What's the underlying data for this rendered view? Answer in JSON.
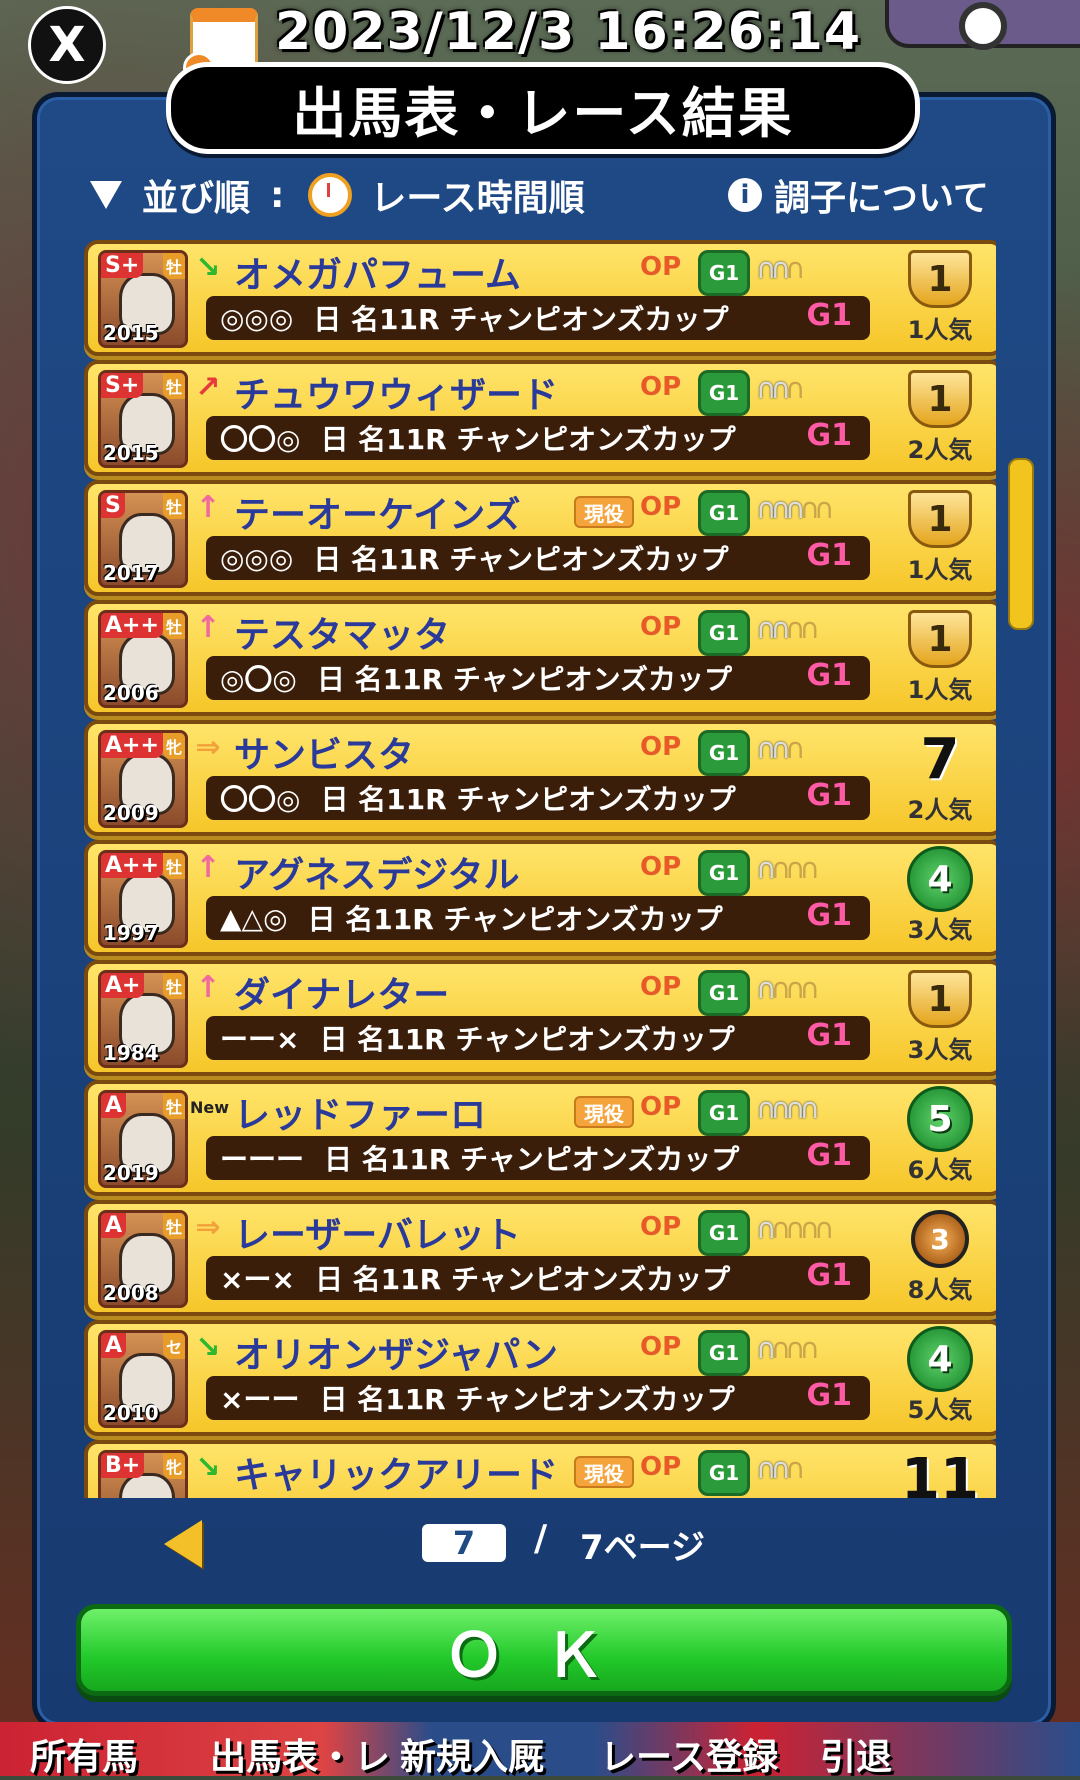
{
  "header": {
    "datetime": "2023/12/3 16:26:14",
    "x_label": "X"
  },
  "panel": {
    "title": "出馬表・レース結果",
    "sort_label": "並び順",
    "sort_colon": ":",
    "sort_value": "レース時間順",
    "info_label": "調子について",
    "info_icon_text": "i"
  },
  "rows": [
    {
      "rank": "S+",
      "sex": "牡",
      "year": "2015",
      "arrow": "↘",
      "arrow_type": "down",
      "name": "オメガパフューム",
      "genyaku": false,
      "op": "OP",
      "grade": "G1",
      "shoes_full": 2,
      "shoes_empty": 1,
      "marks": "◎◎◎",
      "race": "日 名11R チャンピオンズカップ",
      "race_grade": "G1",
      "result": "1",
      "result_type": "trophy",
      "popularity": "1人気",
      "is_new": false
    },
    {
      "rank": "S+",
      "sex": "牡",
      "year": "2015",
      "arrow": "↗",
      "arrow_type": "diag",
      "name": "チュウワウィザード",
      "genyaku": false,
      "op": "OP",
      "grade": "G1",
      "shoes_full": 2,
      "shoes_empty": 1,
      "marks": "〇〇◎",
      "race": "日 名11R チャンピオンズカップ",
      "race_grade": "G1",
      "result": "1",
      "result_type": "trophy",
      "popularity": "2人気",
      "is_new": false
    },
    {
      "rank": "S",
      "sex": "牡",
      "year": "2017",
      "arrow": "↑",
      "arrow_type": "up",
      "name": "テーオーケインズ",
      "genyaku": true,
      "op": "OP",
      "grade": "G1",
      "shoes_full": 3,
      "shoes_empty": 2,
      "marks": "◎◎◎",
      "race": "日 名11R チャンピオンズカップ",
      "race_grade": "G1",
      "result": "1",
      "result_type": "trophy",
      "popularity": "1人気",
      "is_new": false
    },
    {
      "rank": "A++",
      "sex": "牡",
      "year": "2006",
      "arrow": "↑",
      "arrow_type": "up",
      "name": "テスタマッタ",
      "genyaku": false,
      "op": "OP",
      "grade": "G1",
      "shoes_full": 2,
      "shoes_empty": 2,
      "marks": "◎〇◎",
      "race": "日 名11R チャンピオンズカップ",
      "race_grade": "G1",
      "result": "1",
      "result_type": "trophy",
      "popularity": "1人気",
      "is_new": false
    },
    {
      "rank": "A++",
      "sex": "牝",
      "year": "2009",
      "arrow": "⇒",
      "arrow_type": "right",
      "name": "サンビスタ",
      "genyaku": false,
      "op": "OP",
      "grade": "G1",
      "shoes_full": 2,
      "shoes_empty": 1,
      "marks": "〇〇◎",
      "race": "日 名11R チャンピオンズカップ",
      "race_grade": "G1",
      "result": "7",
      "result_type": "plain",
      "popularity": "2人気",
      "is_new": false
    },
    {
      "rank": "A++",
      "sex": "牡",
      "year": "1997",
      "arrow": "↑",
      "arrow_type": "up",
      "name": "アグネスデジタル",
      "genyaku": false,
      "op": "OP",
      "grade": "G1",
      "shoes_full": 1,
      "shoes_empty": 3,
      "marks": "▲△◎",
      "race": "日 名11R チャンピオンズカップ",
      "race_grade": "G1",
      "result": "4",
      "result_type": "wreath",
      "popularity": "3人気",
      "is_new": false
    },
    {
      "rank": "A+",
      "sex": "牡",
      "year": "1984",
      "arrow": "↑",
      "arrow_type": "up",
      "name": "ダイナレター",
      "genyaku": false,
      "op": "OP",
      "grade": "G1",
      "shoes_full": 1,
      "shoes_empty": 3,
      "marks": "ーー×",
      "race": "日 名11R チャンピオンズカップ",
      "race_grade": "G1",
      "result": "1",
      "result_type": "trophy",
      "popularity": "3人気",
      "is_new": false
    },
    {
      "rank": "A",
      "sex": "牡",
      "year": "2019",
      "arrow": "",
      "arrow_type": "new",
      "name": "レッドファーロ",
      "genyaku": true,
      "op": "OP",
      "grade": "G1",
      "shoes_full": 4,
      "shoes_empty": 0,
      "marks": "ーーー",
      "race": "日 名11R チャンピオンズカップ",
      "race_grade": "G1",
      "result": "5",
      "result_type": "wreath",
      "popularity": "6人気",
      "is_new": true,
      "new_label": "New"
    },
    {
      "rank": "A",
      "sex": "牡",
      "year": "2008",
      "arrow": "⇒",
      "arrow_type": "right",
      "name": "レーザーバレット",
      "genyaku": false,
      "op": "OP",
      "grade": "G1",
      "shoes_full": 1,
      "shoes_empty": 4,
      "marks": "×ー×",
      "race": "日 名11R チャンピオンズカップ",
      "race_grade": "G1",
      "result": "3",
      "result_type": "medal",
      "popularity": "8人気",
      "is_new": false
    },
    {
      "rank": "A",
      "sex": "セ",
      "year": "2010",
      "arrow": "↘",
      "arrow_type": "down",
      "name": "オリオンザジャパン",
      "genyaku": false,
      "op": "OP",
      "grade": "G1",
      "shoes_full": 1,
      "shoes_empty": 3,
      "marks": "×ーー",
      "race": "日 名11R チャンピオンズカップ",
      "race_grade": "G1",
      "result": "4",
      "result_type": "wreath",
      "popularity": "5人気",
      "is_new": false
    },
    {
      "rank": "B+",
      "sex": "牝",
      "year": "",
      "arrow": "↘",
      "arrow_type": "down",
      "name": "キャリックアリード",
      "genyaku": true,
      "op": "OP",
      "grade": "G1",
      "shoes_full": 2,
      "shoes_empty": 1,
      "marks": "",
      "race": "",
      "race_grade": "",
      "result": "11",
      "result_type": "plain",
      "popularity": "",
      "is_new": false
    }
  ],
  "genyaku_label": "現役",
  "pager": {
    "current": "7",
    "separator": "/",
    "total": "7ページ"
  },
  "ok_label": "ＯＫ",
  "bottom_menu": [
    "所有馬",
    "出馬表・レース結果",
    "新規入厩",
    "レース登録",
    "引退"
  ],
  "colors": {
    "panel": "#1f4a86",
    "row": "#f6c62a",
    "ok": "#22c92a",
    "name_text": "#2a3a9a"
  }
}
